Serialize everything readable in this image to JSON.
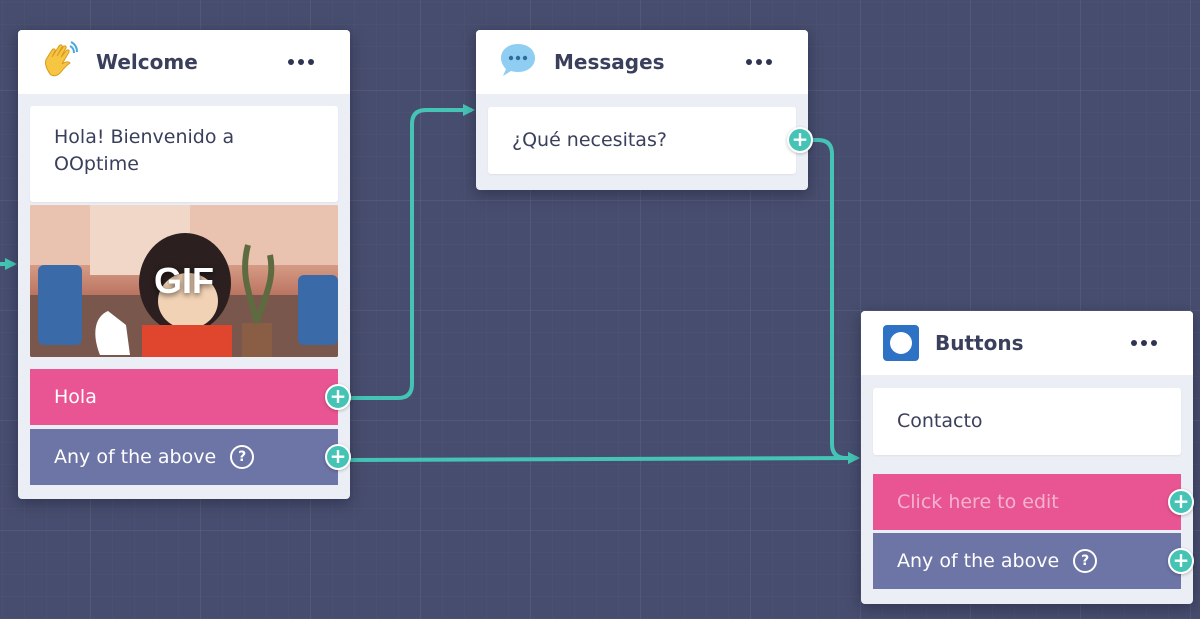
{
  "colors": {
    "canvas": "#474d6e",
    "connector": "#45c4b6",
    "pink_button": "#e85592",
    "purple_button": "#6d74a6",
    "node_icon_blue": "#2e72c5"
  },
  "welcome": {
    "icon": "waving-hand-icon",
    "title": "Welcome",
    "menu": "more-options-icon",
    "message": "Hola! Bienvenido a OOptime",
    "gif_label": "GIF",
    "buttons": [
      {
        "label": "Hola",
        "style": "pink"
      },
      {
        "label": "Any of the above",
        "style": "purple",
        "help_icon": "question-circle-icon"
      }
    ]
  },
  "messages": {
    "icon": "speech-bubble-icon",
    "title": "Messages",
    "menu": "more-options-icon",
    "message": "¿Qué necesitas?"
  },
  "buttons_node": {
    "icon": "button-node-icon",
    "title": "Buttons",
    "menu": "more-options-icon",
    "message": "Contacto",
    "buttons": [
      {
        "label": "Click here to edit",
        "style": "pink",
        "placeholder": true
      },
      {
        "label": "Any of the above",
        "style": "purple",
        "help_icon": "question-circle-icon"
      }
    ]
  },
  "handles": {
    "add": "+"
  },
  "help_glyph": "?"
}
